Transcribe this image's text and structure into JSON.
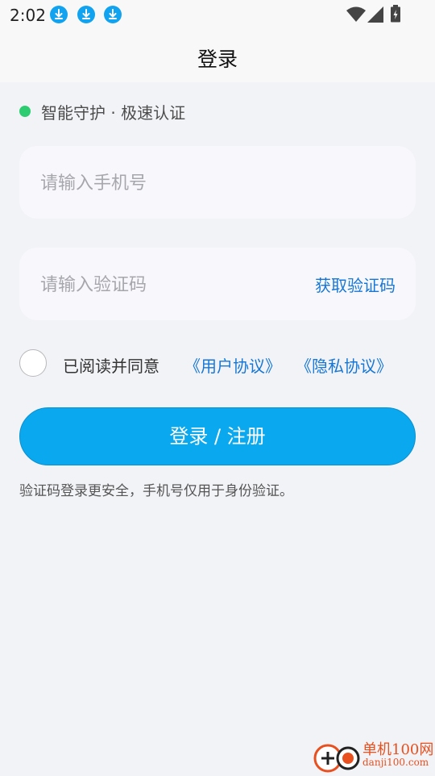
{
  "status_bar": {
    "time": "2:02",
    "download_icons": [
      "download-icon",
      "download-icon",
      "download-icon"
    ],
    "right_icons": [
      "wifi-icon",
      "signal-icon",
      "battery-icon"
    ]
  },
  "header": {
    "title": "登录"
  },
  "hint": {
    "text": "智能守护 · 极速认证",
    "dot_color": "#2ecc71"
  },
  "phone_field": {
    "placeholder": "请输入手机号",
    "value": ""
  },
  "code_field": {
    "placeholder": "请输入验证码",
    "value": "",
    "get_code_label": "获取验证码"
  },
  "agreement": {
    "checked": false,
    "prefix": "已阅读并同意",
    "user_agreement": "《用户协议》",
    "privacy_agreement": "《隐私协议》"
  },
  "login_button": {
    "label": "登录 / 注册"
  },
  "note": "验证码登录更安全，手机号仅用于身份验证。",
  "watermark": {
    "name": "单机100网",
    "url": "danji100.com"
  },
  "colors": {
    "accent": "#0aa9ef",
    "link": "#1677d6",
    "background": "#f2f3f7",
    "status_ok": "#2ecc71"
  }
}
